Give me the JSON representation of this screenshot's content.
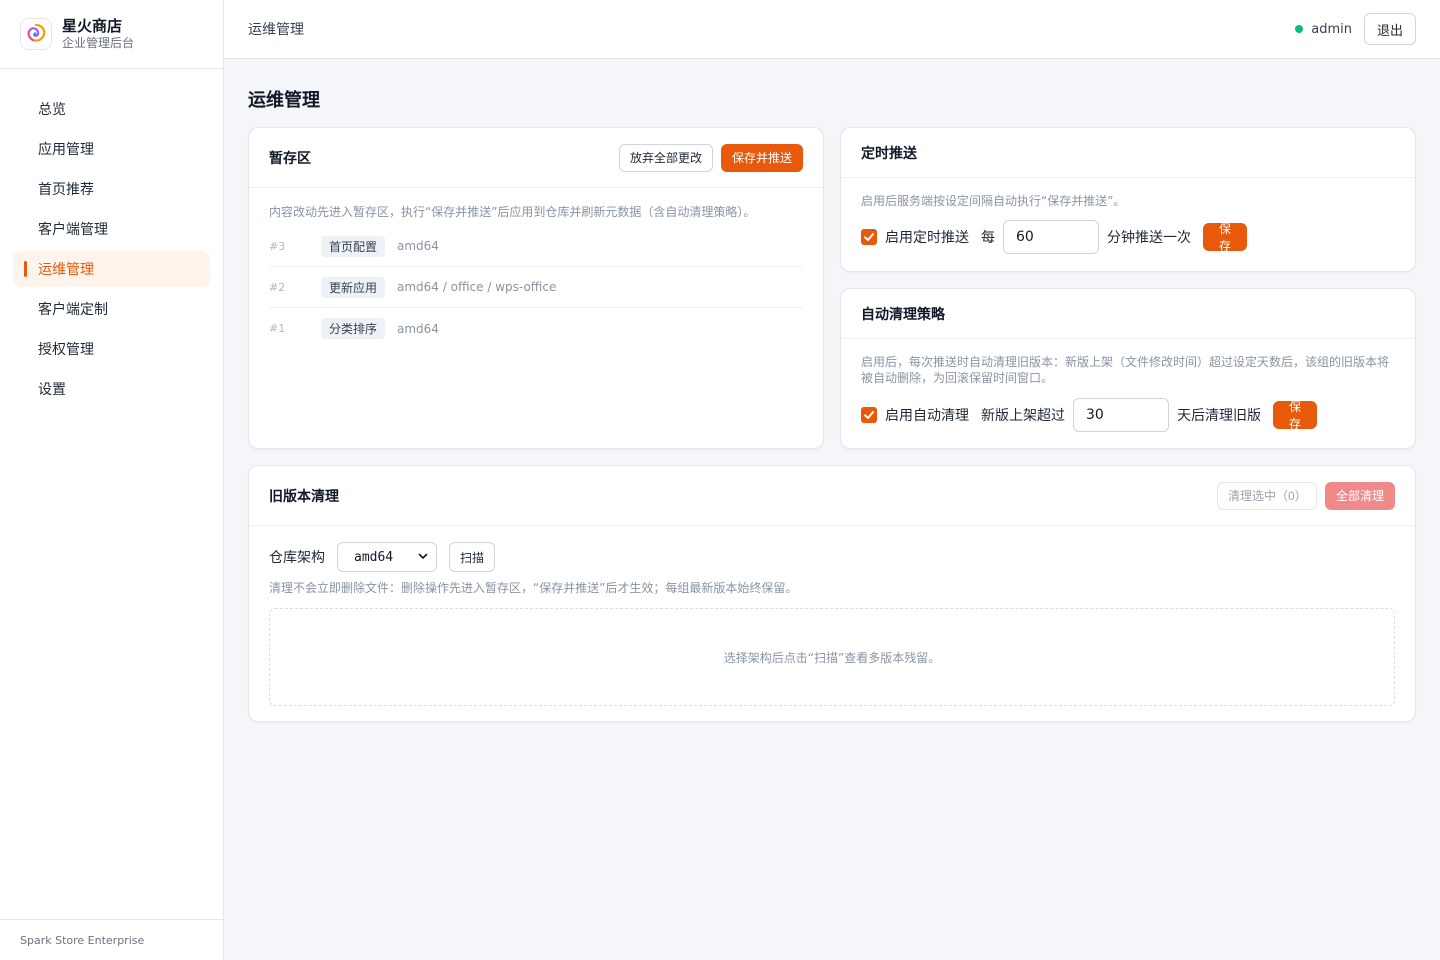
{
  "brand": {
    "title": "星火商店",
    "subtitle": "企业管理后台",
    "footer": "Spark Store Enterprise"
  },
  "nav": [
    {
      "label": "总览",
      "active": false
    },
    {
      "label": "应用管理",
      "active": false
    },
    {
      "label": "首页推荐",
      "active": false
    },
    {
      "label": "客户端管理",
      "active": false
    },
    {
      "label": "运维管理",
      "active": true
    },
    {
      "label": "客户端定制",
      "active": false
    },
    {
      "label": "授权管理",
      "active": false
    },
    {
      "label": "设置",
      "active": false
    }
  ],
  "topbar": {
    "breadcrumb": "运维管理",
    "user": "admin",
    "logout": "退出",
    "status_color": "#10b981"
  },
  "page": {
    "title": "运维管理"
  },
  "staging": {
    "title": "暂存区",
    "discard_label": "放弃全部更改",
    "save_push_label": "保存并推送",
    "hint": "内容改动先进入暂存区，执行“保存并推送”后应用到仓库并刷新元数据（含自动清理策略）。",
    "items": [
      {
        "id": "#3",
        "tag": "首页配置",
        "path": "amd64"
      },
      {
        "id": "#2",
        "tag": "更新应用",
        "path": "amd64 / office / wps-office"
      },
      {
        "id": "#1",
        "tag": "分类排序",
        "path": "amd64"
      }
    ]
  },
  "schedule": {
    "title": "定时推送",
    "hint": "启用后服务端按设定间隔自动执行“保存并推送”。",
    "enable_label": "启用定时推送",
    "enabled": true,
    "prefix": "每",
    "value": "60",
    "suffix": "分钟推送一次",
    "save_label": "保存"
  },
  "cleanup_policy": {
    "title": "自动清理策略",
    "hint": "启用后，每次推送时自动清理旧版本：新版上架（文件修改时间）超过设定天数后，该组的旧版本将被自动删除，为回滚保留时间窗口。",
    "enable_label": "启用自动清理",
    "enabled": true,
    "prefix": "新版上架超过",
    "value": "30",
    "suffix": "天后清理旧版",
    "save_label": "保存"
  },
  "old_versions": {
    "title": "旧版本清理",
    "clean_selected_label": "清理选中（0）",
    "clean_all_label": "全部清理",
    "arch_label": "仓库架构",
    "arch_value": "amd64",
    "scan_label": "扫描",
    "hint": "清理不会立即删除文件：删除操作先进入暂存区，“保存并推送”后才生效；每组最新版本始终保留。",
    "empty_text": "选择架构后点击“扫描”查看多版本残留。"
  },
  "colors": {
    "accent": "#e8590c",
    "danger_light": "#f08a8a"
  }
}
